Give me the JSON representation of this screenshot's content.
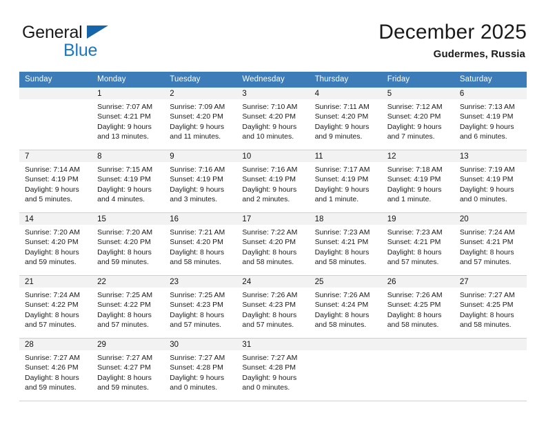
{
  "brand": {
    "name_part1": "General",
    "name_part2": "Blue",
    "triangle_color": "#1565a8",
    "blue_color": "#1b76c4"
  },
  "header": {
    "title": "December 2025",
    "subtitle": "Gudermes, Russia"
  },
  "theme": {
    "header_row_bg": "#3b7cb9",
    "daynum_band_bg": "#f2f2f2",
    "cell_border": "#cfcfcf",
    "week_border": "#3b7cb9"
  },
  "weekday_headers": [
    "Sunday",
    "Monday",
    "Tuesday",
    "Wednesday",
    "Thursday",
    "Friday",
    "Saturday"
  ],
  "weeks": [
    [
      {
        "day": "",
        "sunrise": "",
        "sunset": "",
        "daylight_l1": "",
        "daylight_l2": "",
        "empty": true
      },
      {
        "day": "1",
        "sunrise": "Sunrise: 7:07 AM",
        "sunset": "Sunset: 4:21 PM",
        "daylight_l1": "Daylight: 9 hours",
        "daylight_l2": "and 13 minutes."
      },
      {
        "day": "2",
        "sunrise": "Sunrise: 7:09 AM",
        "sunset": "Sunset: 4:20 PM",
        "daylight_l1": "Daylight: 9 hours",
        "daylight_l2": "and 11 minutes."
      },
      {
        "day": "3",
        "sunrise": "Sunrise: 7:10 AM",
        "sunset": "Sunset: 4:20 PM",
        "daylight_l1": "Daylight: 9 hours",
        "daylight_l2": "and 10 minutes."
      },
      {
        "day": "4",
        "sunrise": "Sunrise: 7:11 AM",
        "sunset": "Sunset: 4:20 PM",
        "daylight_l1": "Daylight: 9 hours",
        "daylight_l2": "and 9 minutes."
      },
      {
        "day": "5",
        "sunrise": "Sunrise: 7:12 AM",
        "sunset": "Sunset: 4:20 PM",
        "daylight_l1": "Daylight: 9 hours",
        "daylight_l2": "and 7 minutes."
      },
      {
        "day": "6",
        "sunrise": "Sunrise: 7:13 AM",
        "sunset": "Sunset: 4:19 PM",
        "daylight_l1": "Daylight: 9 hours",
        "daylight_l2": "and 6 minutes."
      }
    ],
    [
      {
        "day": "7",
        "sunrise": "Sunrise: 7:14 AM",
        "sunset": "Sunset: 4:19 PM",
        "daylight_l1": "Daylight: 9 hours",
        "daylight_l2": "and 5 minutes."
      },
      {
        "day": "8",
        "sunrise": "Sunrise: 7:15 AM",
        "sunset": "Sunset: 4:19 PM",
        "daylight_l1": "Daylight: 9 hours",
        "daylight_l2": "and 4 minutes."
      },
      {
        "day": "9",
        "sunrise": "Sunrise: 7:16 AM",
        "sunset": "Sunset: 4:19 PM",
        "daylight_l1": "Daylight: 9 hours",
        "daylight_l2": "and 3 minutes."
      },
      {
        "day": "10",
        "sunrise": "Sunrise: 7:16 AM",
        "sunset": "Sunset: 4:19 PM",
        "daylight_l1": "Daylight: 9 hours",
        "daylight_l2": "and 2 minutes."
      },
      {
        "day": "11",
        "sunrise": "Sunrise: 7:17 AM",
        "sunset": "Sunset: 4:19 PM",
        "daylight_l1": "Daylight: 9 hours",
        "daylight_l2": "and 1 minute."
      },
      {
        "day": "12",
        "sunrise": "Sunrise: 7:18 AM",
        "sunset": "Sunset: 4:19 PM",
        "daylight_l1": "Daylight: 9 hours",
        "daylight_l2": "and 1 minute."
      },
      {
        "day": "13",
        "sunrise": "Sunrise: 7:19 AM",
        "sunset": "Sunset: 4:19 PM",
        "daylight_l1": "Daylight: 9 hours",
        "daylight_l2": "and 0 minutes."
      }
    ],
    [
      {
        "day": "14",
        "sunrise": "Sunrise: 7:20 AM",
        "sunset": "Sunset: 4:20 PM",
        "daylight_l1": "Daylight: 8 hours",
        "daylight_l2": "and 59 minutes."
      },
      {
        "day": "15",
        "sunrise": "Sunrise: 7:20 AM",
        "sunset": "Sunset: 4:20 PM",
        "daylight_l1": "Daylight: 8 hours",
        "daylight_l2": "and 59 minutes."
      },
      {
        "day": "16",
        "sunrise": "Sunrise: 7:21 AM",
        "sunset": "Sunset: 4:20 PM",
        "daylight_l1": "Daylight: 8 hours",
        "daylight_l2": "and 58 minutes."
      },
      {
        "day": "17",
        "sunrise": "Sunrise: 7:22 AM",
        "sunset": "Sunset: 4:20 PM",
        "daylight_l1": "Daylight: 8 hours",
        "daylight_l2": "and 58 minutes."
      },
      {
        "day": "18",
        "sunrise": "Sunrise: 7:23 AM",
        "sunset": "Sunset: 4:21 PM",
        "daylight_l1": "Daylight: 8 hours",
        "daylight_l2": "and 58 minutes."
      },
      {
        "day": "19",
        "sunrise": "Sunrise: 7:23 AM",
        "sunset": "Sunset: 4:21 PM",
        "daylight_l1": "Daylight: 8 hours",
        "daylight_l2": "and 57 minutes."
      },
      {
        "day": "20",
        "sunrise": "Sunrise: 7:24 AM",
        "sunset": "Sunset: 4:21 PM",
        "daylight_l1": "Daylight: 8 hours",
        "daylight_l2": "and 57 minutes."
      }
    ],
    [
      {
        "day": "21",
        "sunrise": "Sunrise: 7:24 AM",
        "sunset": "Sunset: 4:22 PM",
        "daylight_l1": "Daylight: 8 hours",
        "daylight_l2": "and 57 minutes."
      },
      {
        "day": "22",
        "sunrise": "Sunrise: 7:25 AM",
        "sunset": "Sunset: 4:22 PM",
        "daylight_l1": "Daylight: 8 hours",
        "daylight_l2": "and 57 minutes."
      },
      {
        "day": "23",
        "sunrise": "Sunrise: 7:25 AM",
        "sunset": "Sunset: 4:23 PM",
        "daylight_l1": "Daylight: 8 hours",
        "daylight_l2": "and 57 minutes."
      },
      {
        "day": "24",
        "sunrise": "Sunrise: 7:26 AM",
        "sunset": "Sunset: 4:23 PM",
        "daylight_l1": "Daylight: 8 hours",
        "daylight_l2": "and 57 minutes."
      },
      {
        "day": "25",
        "sunrise": "Sunrise: 7:26 AM",
        "sunset": "Sunset: 4:24 PM",
        "daylight_l1": "Daylight: 8 hours",
        "daylight_l2": "and 58 minutes."
      },
      {
        "day": "26",
        "sunrise": "Sunrise: 7:26 AM",
        "sunset": "Sunset: 4:25 PM",
        "daylight_l1": "Daylight: 8 hours",
        "daylight_l2": "and 58 minutes."
      },
      {
        "day": "27",
        "sunrise": "Sunrise: 7:27 AM",
        "sunset": "Sunset: 4:25 PM",
        "daylight_l1": "Daylight: 8 hours",
        "daylight_l2": "and 58 minutes."
      }
    ],
    [
      {
        "day": "28",
        "sunrise": "Sunrise: 7:27 AM",
        "sunset": "Sunset: 4:26 PM",
        "daylight_l1": "Daylight: 8 hours",
        "daylight_l2": "and 59 minutes."
      },
      {
        "day": "29",
        "sunrise": "Sunrise: 7:27 AM",
        "sunset": "Sunset: 4:27 PM",
        "daylight_l1": "Daylight: 8 hours",
        "daylight_l2": "and 59 minutes."
      },
      {
        "day": "30",
        "sunrise": "Sunrise: 7:27 AM",
        "sunset": "Sunset: 4:28 PM",
        "daylight_l1": "Daylight: 9 hours",
        "daylight_l2": "and 0 minutes."
      },
      {
        "day": "31",
        "sunrise": "Sunrise: 7:27 AM",
        "sunset": "Sunset: 4:28 PM",
        "daylight_l1": "Daylight: 9 hours",
        "daylight_l2": "and 0 minutes."
      },
      {
        "day": "",
        "sunrise": "",
        "sunset": "",
        "daylight_l1": "",
        "daylight_l2": "",
        "empty": true
      },
      {
        "day": "",
        "sunrise": "",
        "sunset": "",
        "daylight_l1": "",
        "daylight_l2": "",
        "empty": true
      },
      {
        "day": "",
        "sunrise": "",
        "sunset": "",
        "daylight_l1": "",
        "daylight_l2": "",
        "empty": true
      }
    ]
  ]
}
